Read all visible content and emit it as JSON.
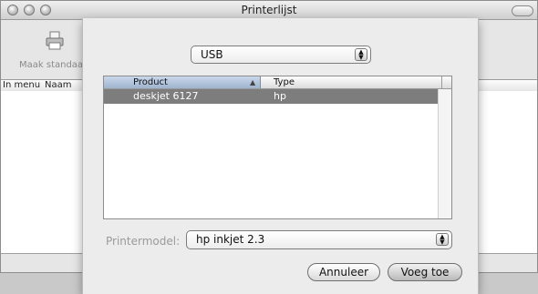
{
  "window": {
    "title": "Printerlijst"
  },
  "toolbar": {
    "make_default_label": "Maak standaard",
    "icon": "printer-icon"
  },
  "list": {
    "columns": [
      "In menu",
      "Naam"
    ]
  },
  "sheet": {
    "connection": {
      "selected": "USB"
    },
    "table": {
      "headers": {
        "product": "Product",
        "type": "Type"
      },
      "rows": [
        {
          "product": "deskjet 6127",
          "type": "hp",
          "selected": true
        }
      ]
    },
    "printermodel": {
      "label": "Printermodel:",
      "selected": "hp inkjet 2.3"
    },
    "buttons": {
      "cancel": "Annuleer",
      "add": "Voeg toe"
    }
  },
  "colors": {
    "selection": "#7d7d7d",
    "sheet_bg": "#ececec",
    "window_bg": "#e6e6e6"
  }
}
